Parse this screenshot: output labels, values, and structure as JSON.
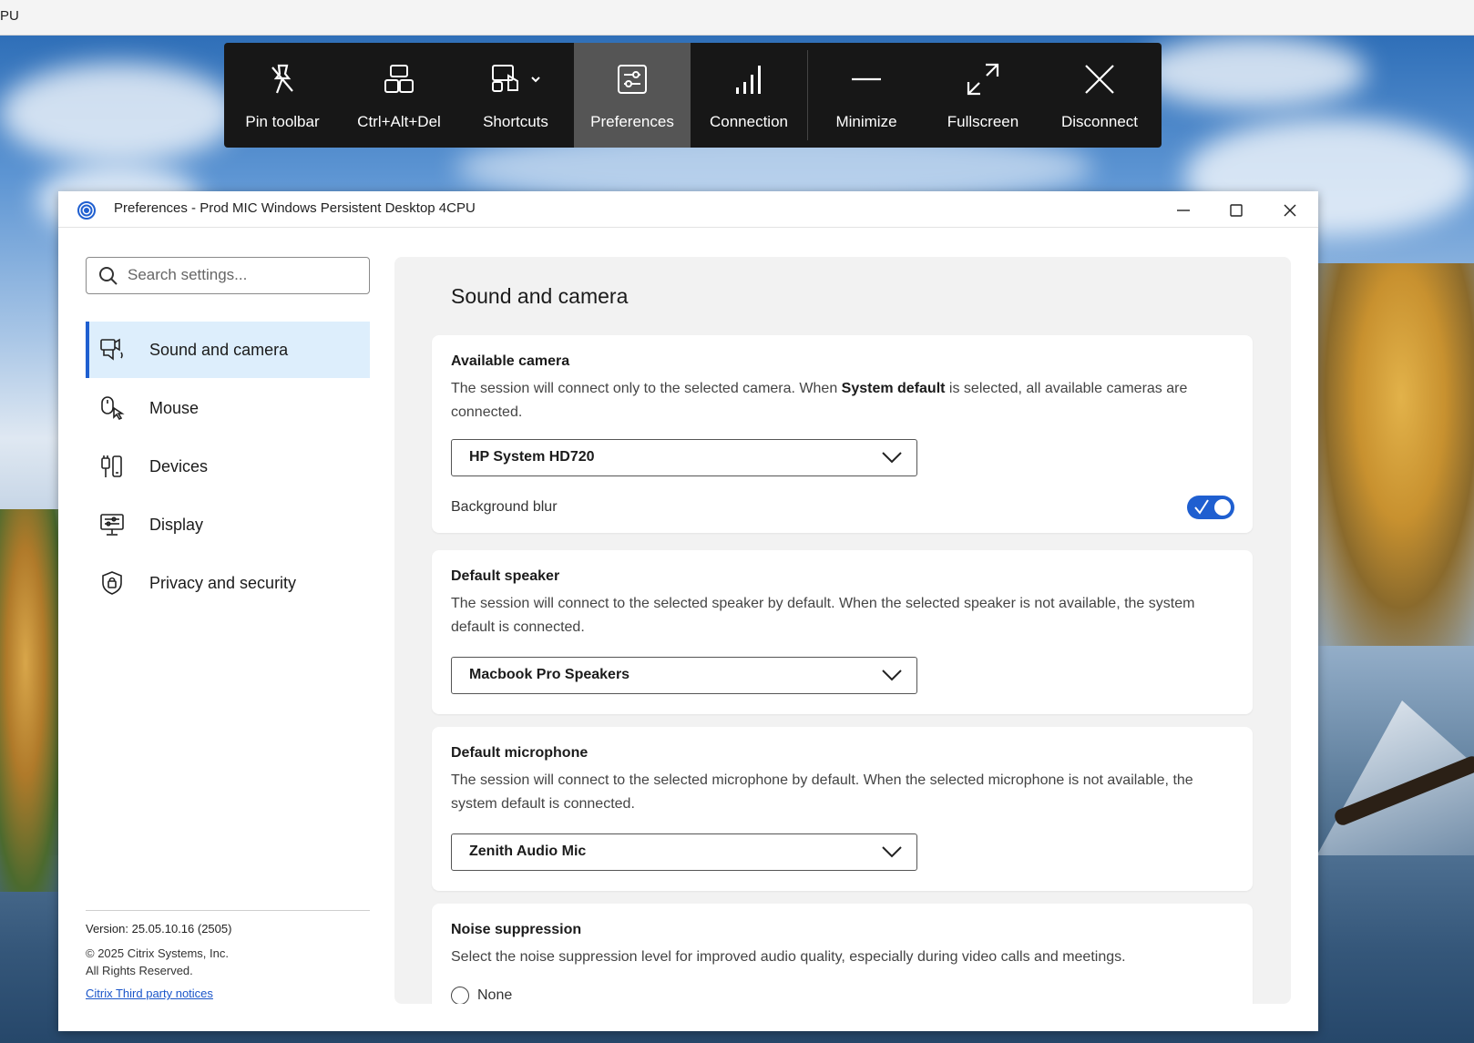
{
  "top_strip": {
    "text": "PU"
  },
  "toolbar": {
    "items": [
      {
        "label": "Pin toolbar",
        "icon": "pin-icon"
      },
      {
        "label": "Ctrl+Alt+Del",
        "icon": "ctrl-alt-del-icon"
      },
      {
        "label": "Shortcuts",
        "icon": "shortcuts-icon"
      },
      {
        "label": "Preferences",
        "icon": "preferences-icon",
        "active": true
      },
      {
        "label": "Connection",
        "icon": "signal-icon"
      },
      {
        "label": "Minimize",
        "icon": "minimize-icon"
      },
      {
        "label": "Fullscreen",
        "icon": "fullscreen-icon"
      },
      {
        "label": "Disconnect",
        "icon": "disconnect-icon"
      }
    ]
  },
  "window": {
    "title": "Preferences - Prod MIC Windows Persistent Desktop 4CPU"
  },
  "sidebar": {
    "search_placeholder": "Search settings...",
    "items": [
      {
        "label": "Sound and camera",
        "icon": "camera-audio-icon",
        "active": true
      },
      {
        "label": "Mouse",
        "icon": "mouse-icon"
      },
      {
        "label": "Devices",
        "icon": "devices-icon"
      },
      {
        "label": "Display",
        "icon": "display-icon"
      },
      {
        "label": "Privacy and security",
        "icon": "lock-shield-icon"
      }
    ],
    "version": "Version: 25.05.10.16 (2505)",
    "copyright_line1": "© 2025 Citrix Systems, Inc.",
    "copyright_line2": "All Rights Reserved.",
    "notices_link": "Citrix Third party notices"
  },
  "content": {
    "title": "Sound and camera",
    "camera": {
      "title": "Available camera",
      "desc_part1": "The session will connect only to the selected camera. When ",
      "desc_bold": "System default",
      "desc_part2": " is selected, all available cameras are connected.",
      "selected": "HP System HD720",
      "blur_label": "Background blur",
      "blur_enabled": true
    },
    "speaker": {
      "title": "Default speaker",
      "desc": "The session will connect to the selected speaker by default. When the selected speaker is not available, the system default is connected.",
      "selected": "Macbook Pro Speakers"
    },
    "microphone": {
      "title": "Default microphone",
      "desc": "The session will connect to the selected microphone by default. When the selected microphone is not available, the system default is connected.",
      "selected": "Zenith Audio Mic"
    },
    "noise": {
      "title": "Noise suppression",
      "desc": "Select the noise suppression level for improved audio quality, especially during video calls and meetings.",
      "option_none": "None"
    }
  },
  "colors": {
    "accent": "#1f5fd0",
    "toolbar_bg": "#171717",
    "toolbar_active": "#555555",
    "nav_active_bg": "#ddeefc"
  }
}
